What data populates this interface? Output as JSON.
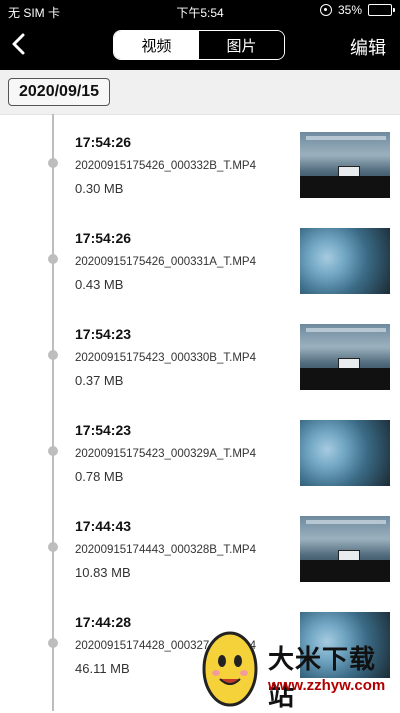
{
  "status": {
    "carrier": "无 SIM 卡",
    "time": "下午5:54",
    "battery_percent_text": "35%",
    "battery_level": 0.35
  },
  "nav": {
    "tab_video": "视频",
    "tab_photo": "图片",
    "edit_label": "编辑"
  },
  "date_header": "2020/09/15",
  "items": [
    {
      "time": "17:54:26",
      "file": "20200915175426_000332B_T.MP4",
      "size": "0.30 MB",
      "thumb": "B"
    },
    {
      "time": "17:54:26",
      "file": "20200915175426_000331A_T.MP4",
      "size": "0.43 MB",
      "thumb": "A"
    },
    {
      "time": "17:54:23",
      "file": "20200915175423_000330B_T.MP4",
      "size": "0.37 MB",
      "thumb": "B"
    },
    {
      "time": "17:54:23",
      "file": "20200915175423_000329A_T.MP4",
      "size": "0.78 MB",
      "thumb": "A"
    },
    {
      "time": "17:44:43",
      "file": "20200915174443_000328B_T.MP4",
      "size": "10.83 MB",
      "thumb": "B"
    },
    {
      "time": "17:44:28",
      "file": "20200915174428_000327A_T.MP4",
      "size": "46.11 MB",
      "thumb": "A"
    }
  ],
  "watermark": {
    "title": "大米下载站",
    "url": "www.zzhyw.com"
  },
  "colors": {
    "topbar": "#000000",
    "accent_url": "#b00000"
  }
}
